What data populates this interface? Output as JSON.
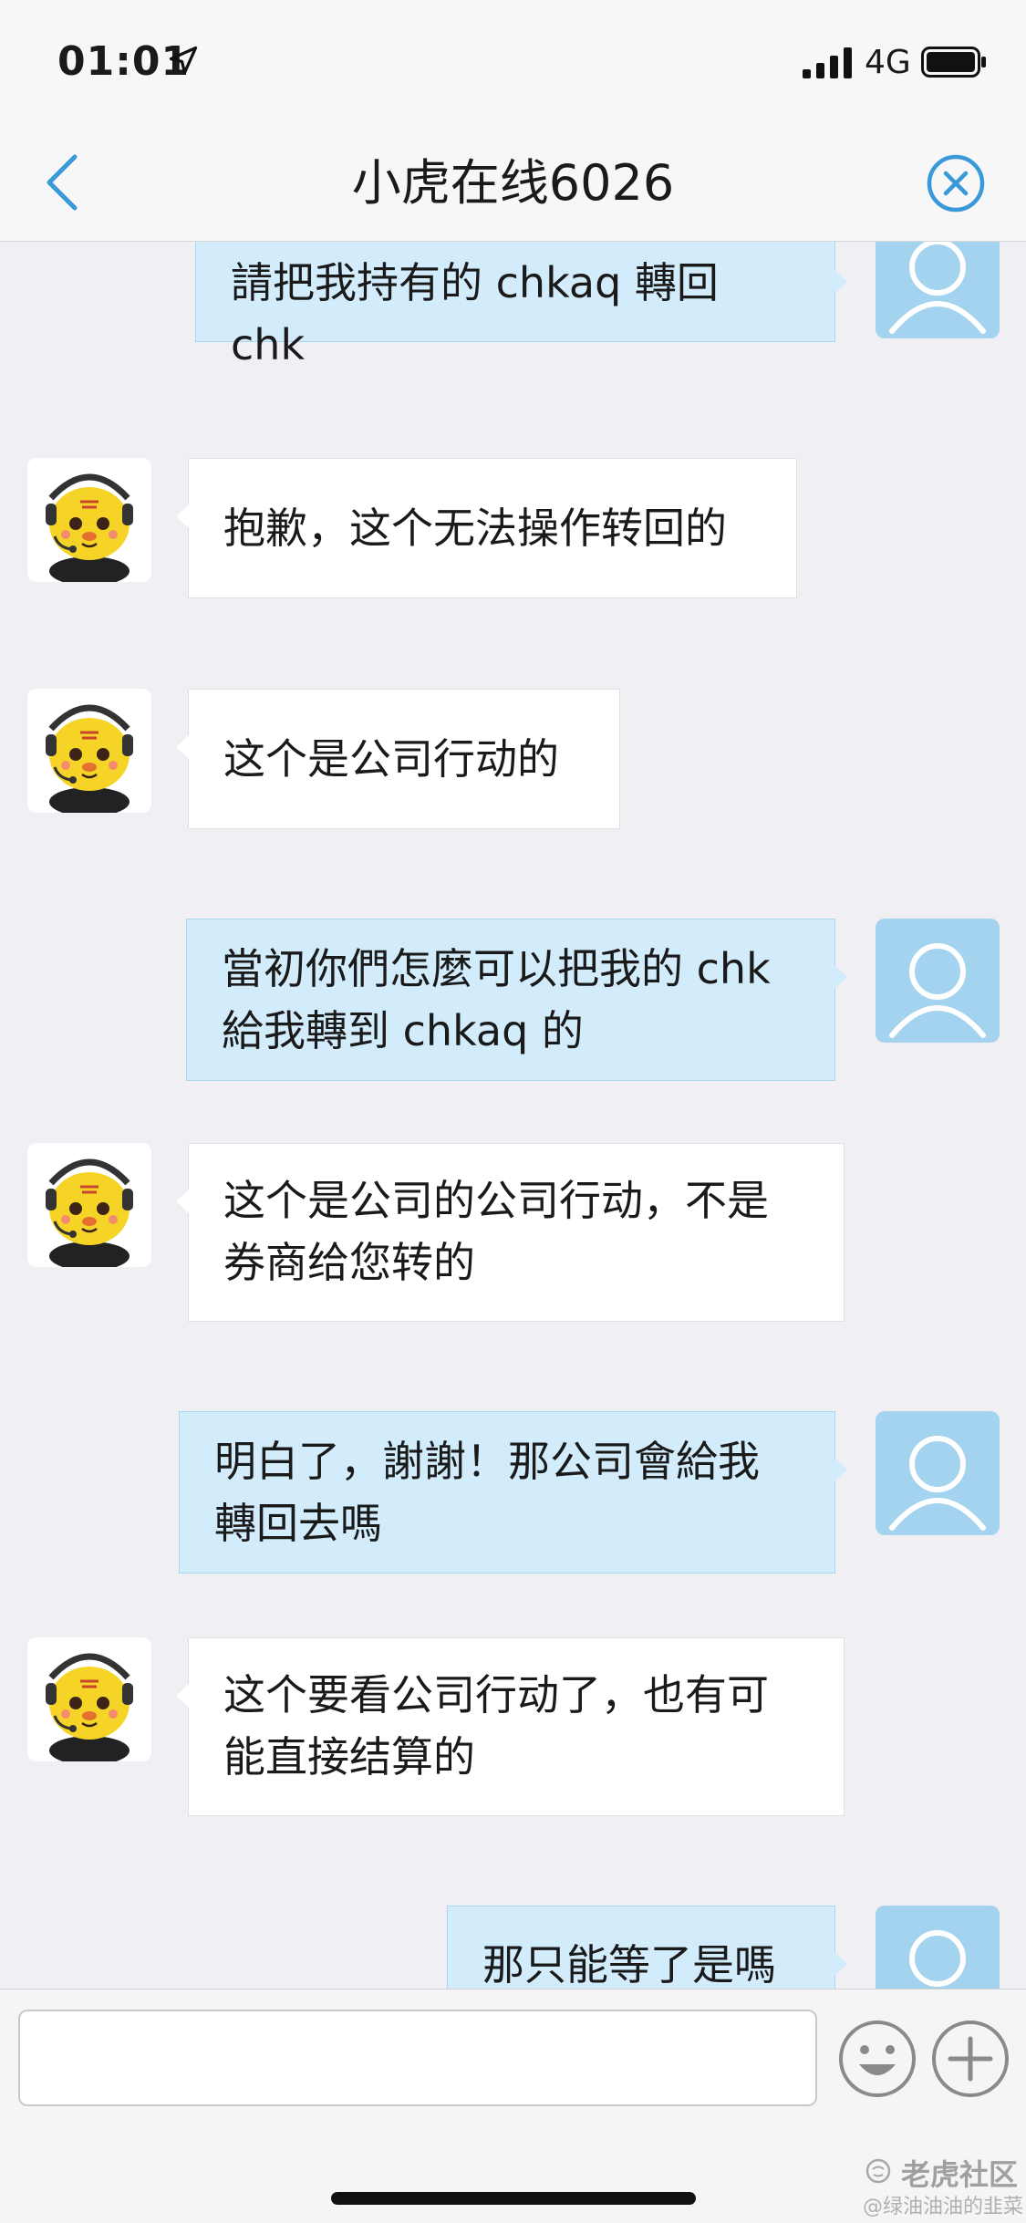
{
  "status_bar": {
    "time": "01:01",
    "network": "4G",
    "icons": [
      "location-arrow-icon",
      "signal-bars-icon",
      "battery-icon"
    ]
  },
  "nav": {
    "title": "小虎在线6026",
    "back_icon": "chevron-left-icon",
    "close_icon": "close-circle-icon"
  },
  "messages": [
    {
      "sender": "user",
      "lines": [
        "請把我持有的 chkaq 轉回 chk"
      ]
    },
    {
      "sender": "agent",
      "lines": [
        "抱歉，这个无法操作转回的"
      ]
    },
    {
      "sender": "agent",
      "lines": [
        "这个是公司行动的"
      ]
    },
    {
      "sender": "user",
      "lines": [
        "當初你們怎麼可以把我的 chk",
        "給我轉到 chkaq 的"
      ]
    },
    {
      "sender": "agent",
      "lines": [
        "这个是公司的公司行动，不是",
        "券商给您转的"
      ]
    },
    {
      "sender": "user",
      "lines": [
        "明白了，謝謝！那公司會給我",
        "轉回去嗎"
      ]
    },
    {
      "sender": "agent",
      "lines": [
        "这个要看公司行动了，也有可",
        "能直接结算的"
      ]
    },
    {
      "sender": "user",
      "lines": [
        "那只能等了是嗎"
      ]
    }
  ],
  "input_bar": {
    "value": "",
    "emoji_icon": "smiley-face-icon",
    "add_icon": "plus-circle-icon"
  },
  "watermark": {
    "brand": "老虎社区",
    "handle": "@绿油油油的韭菜"
  },
  "colors": {
    "accent": "#3a9ad9",
    "user_bubble": "#d2ecfb",
    "agent_bubble": "#ffffff",
    "background": "#efeff4",
    "user_avatar": "#a3d3ef"
  }
}
